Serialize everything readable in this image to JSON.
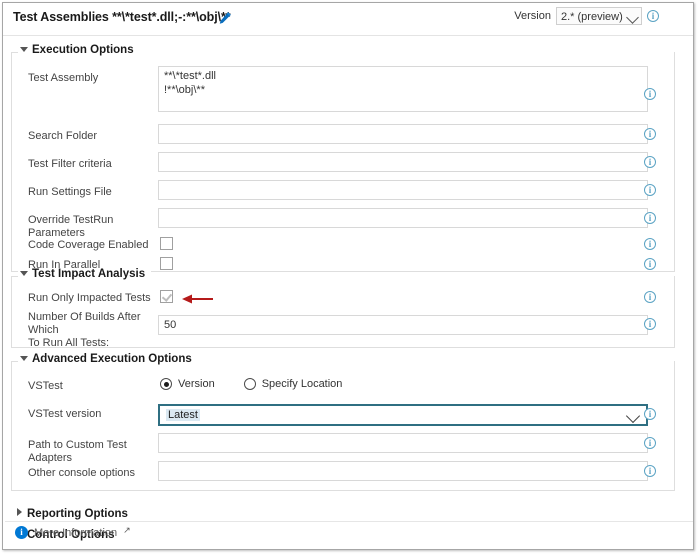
{
  "header": {
    "title": "Test Assemblies **\\*test*.dll;-:**\\obj\\**",
    "edit_icon": "pencil-icon",
    "version_label": "Version",
    "version_value": "2.* (preview)",
    "version_info_icon": "info-icon"
  },
  "sections": {
    "execution_options": {
      "legend": "Execution Options",
      "expanded": true,
      "rows": [
        {
          "label": "Test Assembly",
          "type": "textarea",
          "value": "**\\*test*.dll\n!**\\obj\\**",
          "info": "ⓘ"
        },
        {
          "label": "Search Folder",
          "type": "text",
          "value": "",
          "info": "ⓘ"
        },
        {
          "label": "Test Filter criteria",
          "type": "text",
          "value": "",
          "info": "ⓘ"
        },
        {
          "label": "Run Settings File",
          "type": "text",
          "value": "",
          "info": "ⓘ"
        },
        {
          "label": "Override TestRun Parameters",
          "type": "text",
          "value": "",
          "info": "ⓘ"
        },
        {
          "label": "Code Coverage Enabled",
          "type": "checkbox",
          "checked": false,
          "info": "ⓘ"
        },
        {
          "label": "Run In Parallel",
          "type": "checkbox",
          "checked": false,
          "info": "ⓘ"
        }
      ]
    },
    "test_impact_analysis": {
      "legend": "Test Impact Analysis",
      "expanded": true,
      "rows": [
        {
          "label": "Run Only Impacted Tests",
          "type": "checkbox",
          "checked": true,
          "annotated": true,
          "info": "ⓘ"
        },
        {
          "label": "Number Of Builds After Which To Run All Tests:",
          "label_line1": "Number Of Builds After Which",
          "label_line2": "To Run All Tests:",
          "type": "text",
          "value": "50",
          "info": "ⓘ"
        }
      ]
    },
    "advanced_execution_options": {
      "legend": "Advanced Execution Options",
      "expanded": true,
      "rows": [
        {
          "label": "VSTest",
          "type": "radio",
          "options": [
            "Version",
            "Specify Location"
          ],
          "selected": "Version"
        },
        {
          "label": "VSTest version",
          "type": "select",
          "value": "Latest",
          "info": "ⓘ"
        },
        {
          "label": "Path to Custom Test Adapters",
          "type": "text",
          "value": "",
          "info": "ⓘ"
        },
        {
          "label": "Other console options",
          "type": "text",
          "value": "",
          "info": "ⓘ"
        }
      ]
    },
    "reporting_options": {
      "legend": "Reporting Options",
      "expanded": false
    },
    "control_options": {
      "legend": "Control Options",
      "expanded": false
    }
  },
  "footer": {
    "more_information": "More Information",
    "external_link_glyph": "↗",
    "info_icon": "i"
  },
  "colors": {
    "accent_blue": "#0078d4",
    "info_icon": "#5ba3c4",
    "focus_border": "#2f6f82",
    "annotation_red": "#b51a1a"
  }
}
